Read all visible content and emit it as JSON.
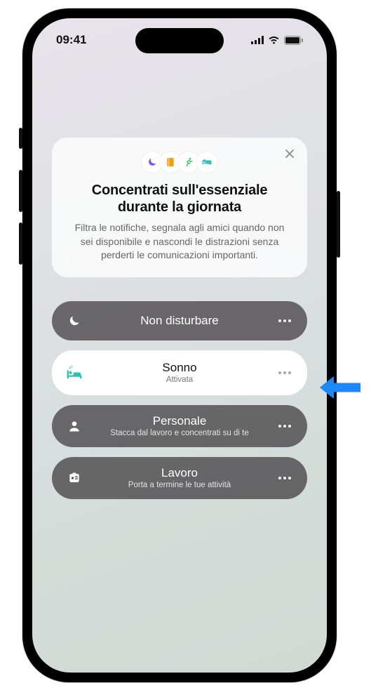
{
  "status": {
    "time": "09:41"
  },
  "info": {
    "title": "Concentrati sull'essenziale durante la giornata",
    "description": "Filtra le notifiche, segnala agli amici quando non sei disponibile e nascondi le distrazioni senza perderti le comunicazioni importanti."
  },
  "focus": {
    "dnd": {
      "label": "Non disturbare"
    },
    "sleep": {
      "label": "Sonno",
      "sub": "Attivata"
    },
    "personal": {
      "label": "Personale",
      "sub": "Stacca dal lavoro e concentrati su di te"
    },
    "work": {
      "label": "Lavoro",
      "sub": "Porta a termine le tue attività"
    }
  },
  "colors": {
    "teal": "#2cc2b4",
    "purple": "#7a5af8",
    "orange": "#f59e0b",
    "green": "#34c759",
    "arrow": "#1e88f7"
  }
}
